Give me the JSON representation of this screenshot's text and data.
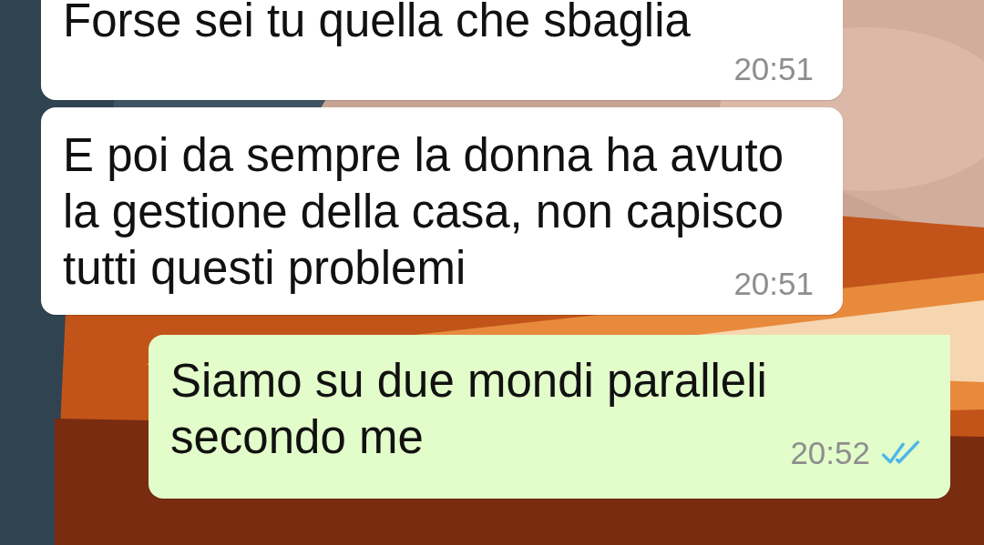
{
  "messages": [
    {
      "kind": "incoming",
      "lines": [
        "Forse sei tu quella che sbaglia"
      ],
      "time": "20:51"
    },
    {
      "kind": "incoming",
      "lines": [
        "E poi da sempre la donna ha avuto",
        "la gestione della casa, non capisco",
        "tutti questi problemi"
      ],
      "time": "20:51"
    },
    {
      "kind": "outgoing",
      "lines": [
        "Siamo su due mondi paralleli",
        "secondo me"
      ],
      "time": "20:52",
      "read": true
    }
  ]
}
